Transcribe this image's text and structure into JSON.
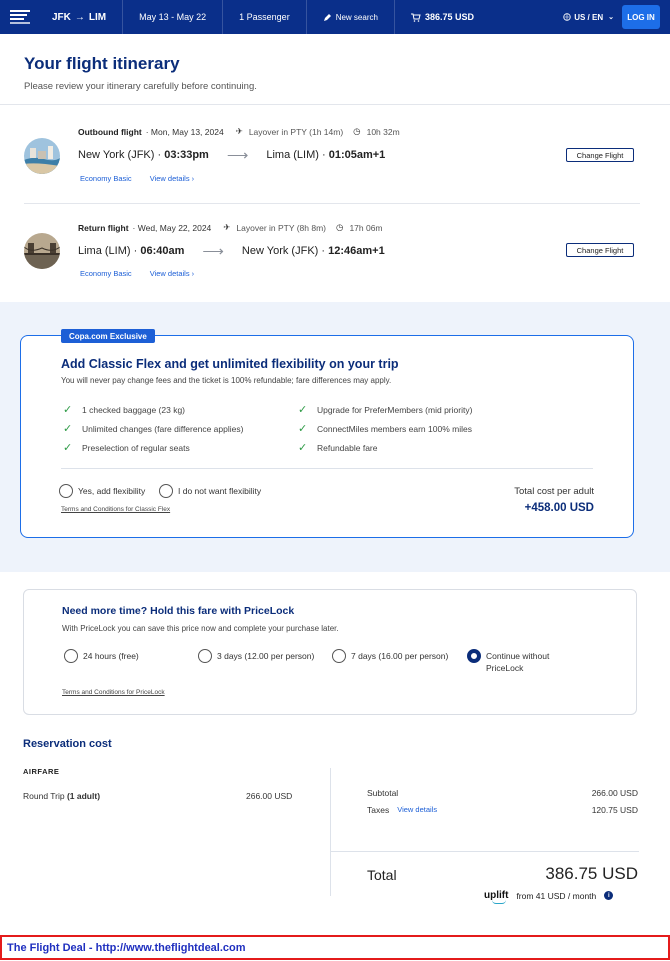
{
  "nav": {
    "origin": "JFK",
    "arrow": "→",
    "destination": "LIM",
    "dates": "May 13 - May 22",
    "passengers": "1 Passenger",
    "new_search": "New search",
    "price": "386.75 USD",
    "locale": "US / EN",
    "login": "LOG IN"
  },
  "header": {
    "title": "Your flight itinerary",
    "subtitle": "Please review your itinerary carefully before continuing."
  },
  "flights": [
    {
      "label": "Outbound flight",
      "date": "· Mon, May 13, 2024",
      "layover": "Layover in PTY (1h 14m)",
      "duration": "10h 32m",
      "from_city": "New York (JFK) ·",
      "from_time": "03:33pm",
      "to_city": "Lima (LIM) ·",
      "to_time": "01:05am+1",
      "fare": "Economy Basic",
      "details": "View details",
      "change": "Change Flight"
    },
    {
      "label": "Return flight",
      "date": "· Wed, May 22, 2024",
      "layover": "Layover in PTY (8h 8m)",
      "duration": "17h 06m",
      "from_city": "Lima (LIM) ·",
      "from_time": "06:40am",
      "to_city": "New York (JFK) ·",
      "to_time": "12:46am+1",
      "fare": "Economy Basic",
      "details": "View details",
      "change": "Change Flight"
    }
  ],
  "flex": {
    "tag": "Copa.com Exclusive",
    "title": "Add Classic Flex and get unlimited flexibility on your trip",
    "subtitle": "You will never pay change fees and the ticket is 100% refundable; fare differences may apply.",
    "benefits_left": [
      "1 checked baggage (23 kg)",
      "Unlimited changes (fare difference applies)",
      "Preselection of regular seats"
    ],
    "benefits_right": [
      "Upgrade for PreferMembers (mid priority)",
      "ConnectMiles members earn 100% miles",
      "Refundable fare"
    ],
    "opt_yes": "Yes, add flexibility",
    "opt_no": "I do not want flexibility",
    "terms": "Terms and Conditions for Classic Flex",
    "total_label": "Total cost per adult",
    "total_value": "+458.00 USD"
  },
  "pricelock": {
    "title": "Need more time? Hold this fare with PriceLock",
    "subtitle": "With PriceLock you can save this price now and complete your purchase later.",
    "options": [
      "24 hours (free)",
      "3 days (12.00 per person)",
      "7 days (16.00 per person)",
      "Continue without PriceLock"
    ],
    "selected_index": 3,
    "terms": "Terms and Conditions for PriceLock"
  },
  "reservation": {
    "title": "Reservation cost",
    "airfare_label": "AIRFARE",
    "round_trip": "Round Trip",
    "adults": "(1 adult)",
    "round_trip_amount": "266.00 USD",
    "subtotal_label": "Subtotal",
    "subtotal": "266.00 USD",
    "taxes_label": "Taxes",
    "taxes_link": "View details",
    "taxes": "120.75 USD",
    "total_label": "Total",
    "total": "386.75 USD",
    "uplift_brand": "uplift",
    "uplift_text": "from 41 USD / month",
    "info": "i"
  },
  "footer": {
    "text": "The Flight Deal - http://www.theflightdeal.com"
  },
  "colors": {
    "brand_navy": "#0a2f8a",
    "accent_blue": "#1d6ee8",
    "check_green": "#2e9b46",
    "footer_red": "#e41b1b"
  }
}
